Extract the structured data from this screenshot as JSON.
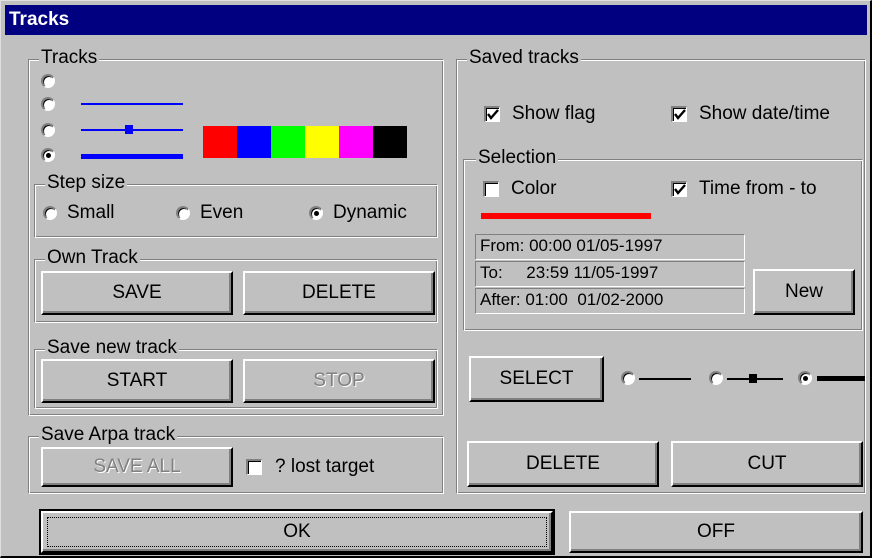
{
  "window": {
    "title": "Tracks"
  },
  "tracks": {
    "label": "Tracks",
    "styles": [
      {
        "name": "none",
        "selected": false
      },
      {
        "name": "thin-line",
        "selected": false
      },
      {
        "name": "line-with-marker",
        "selected": false
      },
      {
        "name": "thick-line",
        "selected": true
      }
    ],
    "colors": [
      "#ff0000",
      "#0000ff",
      "#00ff00",
      "#ffff00",
      "#ff00ff",
      "#000000"
    ]
  },
  "step_size": {
    "label": "Step size",
    "options": [
      {
        "label": "Small",
        "selected": false
      },
      {
        "label": "Even",
        "selected": false
      },
      {
        "label": "Dynamic",
        "selected": true
      }
    ]
  },
  "own_track": {
    "label": "Own Track",
    "save_label": "SAVE",
    "delete_label": "DELETE"
  },
  "save_new_track": {
    "label": "Save new track",
    "start_label": "START",
    "stop_label": "STOP"
  },
  "save_arpa_track": {
    "label": "Save Arpa track",
    "save_all_label": "SAVE ALL",
    "lost_target_label": "? lost target",
    "lost_target_checked": false
  },
  "saved_tracks": {
    "label": "Saved tracks",
    "show_flag_label": "Show flag",
    "show_flag_checked": true,
    "show_datetime_label": "Show date/time",
    "show_datetime_checked": true,
    "selection": {
      "label": "Selection",
      "color_label": "Color",
      "color_checked": false,
      "time_label": "Time from - to",
      "time_checked": true,
      "selected_color": "#ff0000",
      "from_text": "From: 00:00 01/05-1997",
      "to_text": "To:     23:59 11/05-1997",
      "after_text": "After: 01:00  01/02-2000",
      "new_label": "New"
    },
    "select_label": "SELECT",
    "delete_label": "DELETE",
    "cut_label": "CUT",
    "line_styles": [
      {
        "name": "thin-line",
        "selected": false
      },
      {
        "name": "line-with-marker",
        "selected": false
      },
      {
        "name": "thick-line",
        "selected": true
      }
    ]
  },
  "footer": {
    "ok_label": "OK",
    "off_label": "OFF"
  }
}
